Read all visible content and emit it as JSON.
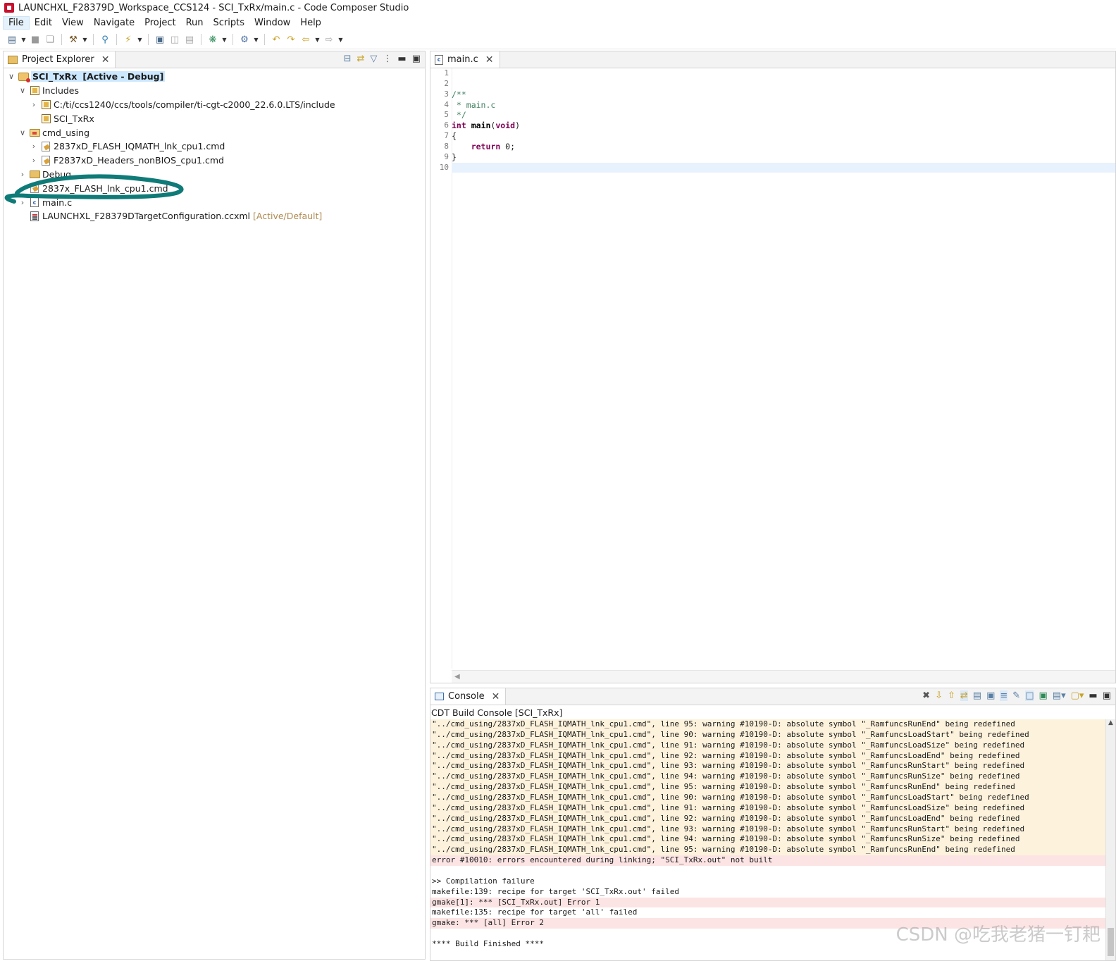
{
  "window": {
    "title": "LAUNCHXL_F28379D_Workspace_CCS124 - SCI_TxRx/main.c - Code Composer Studio"
  },
  "menubar": {
    "items": [
      "File",
      "Edit",
      "View",
      "Navigate",
      "Project",
      "Run",
      "Scripts",
      "Window",
      "Help"
    ]
  },
  "project_explorer": {
    "tab_label": "Project Explorer",
    "tree": [
      {
        "label": "SCI_TxRx",
        "decoration": "[Active - Debug]",
        "depth": 0,
        "expanded": true,
        "icon": "project-icon"
      },
      {
        "label": "Includes",
        "decoration": "",
        "depth": 1,
        "expanded": true,
        "icon": "includes-icon"
      },
      {
        "label": "C:/ti/ccs1240/ccs/tools/compiler/ti-cgt-c2000_22.6.0.LTS/include",
        "decoration": "",
        "depth": 2,
        "expanded": false,
        "icon": "include-folder-icon"
      },
      {
        "label": "SCI_TxRx",
        "decoration": "",
        "depth": 2,
        "expanded": null,
        "icon": "include-folder-icon"
      },
      {
        "label": "cmd_using",
        "decoration": "",
        "depth": 1,
        "expanded": true,
        "icon": "folder-open-icon"
      },
      {
        "label": "2837xD_FLASH_IQMATH_lnk_cpu1.cmd",
        "decoration": "",
        "depth": 2,
        "expanded": false,
        "icon": "cmd-file-icon"
      },
      {
        "label": "F2837xD_Headers_nonBIOS_cpu1.cmd",
        "decoration": "",
        "depth": 2,
        "expanded": false,
        "icon": "cmd-file-icon"
      },
      {
        "label": "Debug",
        "decoration": "",
        "depth": 1,
        "expanded": false,
        "icon": "folder-icon"
      },
      {
        "label": "2837x_FLASH_lnk_cpu1.cmd",
        "decoration": "",
        "depth": 1,
        "expanded": false,
        "icon": "cmd-file-icon"
      },
      {
        "label": "main.c",
        "decoration": "",
        "depth": 1,
        "expanded": false,
        "icon": "c-file-icon"
      },
      {
        "label": "LAUNCHXL_F28379DTargetConfiguration.ccxml",
        "decoration": "[Active/Default]",
        "depth": 1,
        "expanded": null,
        "icon": "ccxml-file-icon"
      }
    ]
  },
  "editor": {
    "tab_label": "main.c",
    "line_numbers": [
      "1",
      "2",
      "3",
      "4",
      "5",
      "6",
      "7",
      "8",
      "9",
      "10"
    ],
    "lines": [
      "",
      "",
      "/**",
      " * main.c",
      " */",
      "int main(void)",
      "{",
      "    return 0;",
      "}",
      ""
    ],
    "current_line": 10
  },
  "console": {
    "tab_label": "Console",
    "title": "CDT Build Console [SCI_TxRx]",
    "lines": [
      {
        "text": "\"../cmd_using/2837xD_FLASH_IQMATH_lnk_cpu1.cmd\", line 95: warning #10190-D: absolute symbol \"_RamfuncsRunEnd\" being redefined",
        "kind": "warning"
      },
      {
        "text": "\"../cmd_using/2837xD_FLASH_IQMATH_lnk_cpu1.cmd\", line 90: warning #10190-D: absolute symbol \"_RamfuncsLoadStart\" being redefined",
        "kind": "warning"
      },
      {
        "text": "\"../cmd_using/2837xD_FLASH_IQMATH_lnk_cpu1.cmd\", line 91: warning #10190-D: absolute symbol \"_RamfuncsLoadSize\" being redefined",
        "kind": "warning"
      },
      {
        "text": "\"../cmd_using/2837xD_FLASH_IQMATH_lnk_cpu1.cmd\", line 92: warning #10190-D: absolute symbol \"_RamfuncsLoadEnd\" being redefined",
        "kind": "warning"
      },
      {
        "text": "\"../cmd_using/2837xD_FLASH_IQMATH_lnk_cpu1.cmd\", line 93: warning #10190-D: absolute symbol \"_RamfuncsRunStart\" being redefined",
        "kind": "warning"
      },
      {
        "text": "\"../cmd_using/2837xD_FLASH_IQMATH_lnk_cpu1.cmd\", line 94: warning #10190-D: absolute symbol \"_RamfuncsRunSize\" being redefined",
        "kind": "warning"
      },
      {
        "text": "\"../cmd_using/2837xD_FLASH_IQMATH_lnk_cpu1.cmd\", line 95: warning #10190-D: absolute symbol \"_RamfuncsRunEnd\" being redefined",
        "kind": "warning"
      },
      {
        "text": "\"../cmd_using/2837xD_FLASH_IQMATH_lnk_cpu1.cmd\", line 90: warning #10190-D: absolute symbol \"_RamfuncsLoadStart\" being redefined",
        "kind": "warning"
      },
      {
        "text": "\"../cmd_using/2837xD_FLASH_IQMATH_lnk_cpu1.cmd\", line 91: warning #10190-D: absolute symbol \"_RamfuncsLoadSize\" being redefined",
        "kind": "warning"
      },
      {
        "text": "\"../cmd_using/2837xD_FLASH_IQMATH_lnk_cpu1.cmd\", line 92: warning #10190-D: absolute symbol \"_RamfuncsLoadEnd\" being redefined",
        "kind": "warning"
      },
      {
        "text": "\"../cmd_using/2837xD_FLASH_IQMATH_lnk_cpu1.cmd\", line 93: warning #10190-D: absolute symbol \"_RamfuncsRunStart\" being redefined",
        "kind": "warning"
      },
      {
        "text": "\"../cmd_using/2837xD_FLASH_IQMATH_lnk_cpu1.cmd\", line 94: warning #10190-D: absolute symbol \"_RamfuncsRunSize\" being redefined",
        "kind": "warning"
      },
      {
        "text": "\"../cmd_using/2837xD_FLASH_IQMATH_lnk_cpu1.cmd\", line 95: warning #10190-D: absolute symbol \"_RamfuncsRunEnd\" being redefined",
        "kind": "warning"
      },
      {
        "text": "error #10010: errors encountered during linking; \"SCI_TxRx.out\" not built",
        "kind": "error"
      },
      {
        "text": "",
        "kind": "info"
      },
      {
        "text": ">> Compilation failure",
        "kind": "info"
      },
      {
        "text": "makefile:139: recipe for target 'SCI_TxRx.out' failed",
        "kind": "info"
      },
      {
        "text": "gmake[1]: *** [SCI_TxRx.out] Error 1",
        "kind": "error"
      },
      {
        "text": "makefile:135: recipe for target 'all' failed",
        "kind": "info"
      },
      {
        "text": "gmake: *** [all] Error 2",
        "kind": "error"
      },
      {
        "text": "",
        "kind": "info"
      },
      {
        "text": "**** Build Finished ****",
        "kind": "info"
      }
    ]
  },
  "watermark": "CSDN @吃我老猪一钉耙",
  "colors": {
    "annotation_stroke": "#0f7b78",
    "warning_bg": "#fdf2dc",
    "error_bg": "#fde4e4",
    "selection_bg": "#cce8ff",
    "keyword": "#7f0055",
    "comment": "#3f7f5f"
  }
}
